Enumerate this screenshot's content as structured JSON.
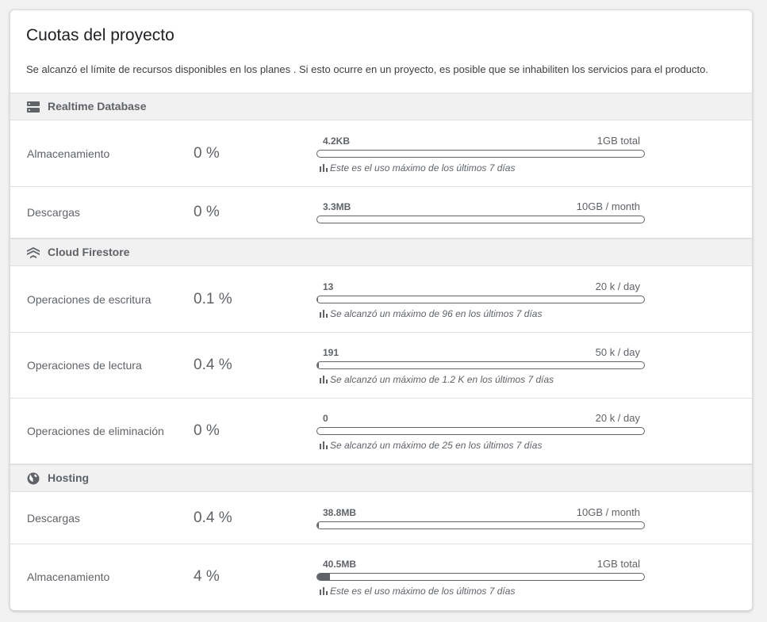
{
  "page": {
    "title": "Cuotas del proyecto",
    "description": "Se alcanzó el límite de recursos disponibles en los planes . Si esto ocurre en un proyecto, es posible que se inhabiliten los servicios para el producto."
  },
  "colors": {
    "bar_fill": "#5f6368",
    "section_bg": "#f1f1f1"
  },
  "sections": [
    {
      "label": "Realtime Database",
      "icon": "database-icon",
      "rows": [
        {
          "label": "Almacenamiento",
          "percent": "0 %",
          "used": "4.2KB",
          "limit": "1GB total",
          "fill_fraction": 0.0,
          "note": "Este es el uso máximo de los últimos 7 días"
        },
        {
          "label": "Descargas",
          "percent": "0 %",
          "used": "3.3MB",
          "limit": "10GB / month",
          "fill_fraction": 0.0,
          "note": null
        }
      ]
    },
    {
      "label": "Cloud Firestore",
      "icon": "firestore-icon",
      "rows": [
        {
          "label": "Operaciones de escritura",
          "percent": "0.1 %",
          "used": "13",
          "limit": "20 k / day",
          "fill_fraction": 0.001,
          "note": "Se alcanzó un máximo de 96 en los últimos 7 días"
        },
        {
          "label": "Operaciones de lectura",
          "percent": "0.4 %",
          "used": "191",
          "limit": "50 k / day",
          "fill_fraction": 0.004,
          "note": "Se alcanzó un máximo de 1.2 K en los últimos 7 días"
        },
        {
          "label": "Operaciones de eliminación",
          "percent": "0 %",
          "used": "0",
          "limit": "20 k / day",
          "fill_fraction": 0.0,
          "note": "Se alcanzó un máximo de 25 en los últimos 7 días"
        }
      ]
    },
    {
      "label": "Hosting",
      "icon": "globe-icon",
      "rows": [
        {
          "label": "Descargas",
          "percent": "0.4 %",
          "used": "38.8MB",
          "limit": "10GB / month",
          "fill_fraction": 0.004,
          "note": null
        },
        {
          "label": "Almacenamiento",
          "percent": "4 %",
          "used": "40.5MB",
          "limit": "1GB total",
          "fill_fraction": 0.04,
          "note": "Este es el uso máximo de los últimos 7 días"
        }
      ]
    }
  ]
}
